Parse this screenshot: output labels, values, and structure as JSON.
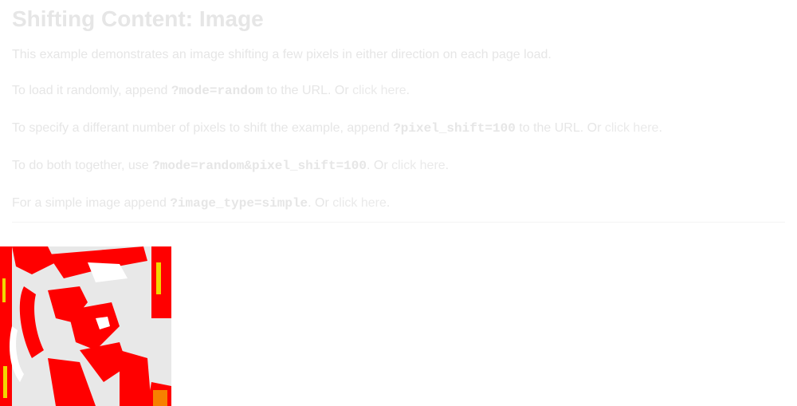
{
  "heading": "Shifting Content: Image",
  "intro": "This example demonstrates an image shifting a few pixels in either direction on each page load.",
  "p_random": {
    "before": "To load it randomly, append ",
    "code": "?mode=random",
    "after": " to the URL. Or ",
    "link": "click here",
    "end": "."
  },
  "p_pixel": {
    "before": "To specify a differant number of pixels to shift the example, append ",
    "code": "?pixel_shift=100",
    "after": " to the URL. Or ",
    "link": "click here",
    "end": "."
  },
  "p_both": {
    "before": "To do both together, use ",
    "code": "?mode=random&pixel_shift=100",
    "after": ". Or ",
    "link": "click here",
    "end": "."
  },
  "p_simple": {
    "before": "For a simple image append ",
    "code": "?image_type=simple",
    "after": ". Or ",
    "link": "click here",
    "end": "."
  },
  "image": {
    "alt_icon": "shifting-image",
    "color_primary": "#ff0000",
    "color_secondary": "#e6e6e6"
  }
}
